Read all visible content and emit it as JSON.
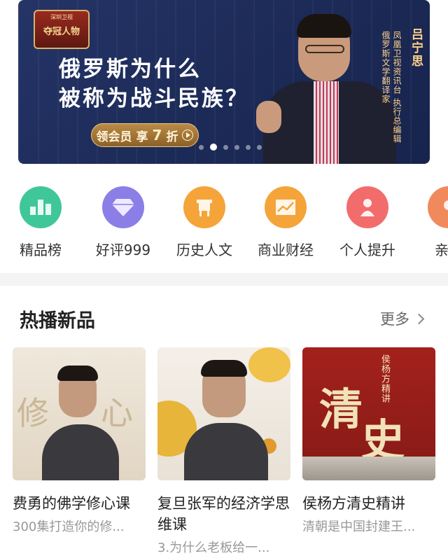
{
  "banner": {
    "badge_top": "深圳卫视",
    "badge_text": "夺冠人物",
    "headline_line1": "俄罗斯为什么",
    "headline_line2": "被称为战斗民族？",
    "vip_label": "领会员",
    "vip_discount_prefix": "享",
    "vip_discount_num": "7",
    "vip_discount_suffix": "折",
    "speaker_name": "吕宁思",
    "speaker_title1": "凤凰卫视资讯台 执行总编辑",
    "speaker_title2": "俄罗斯文学翻译家",
    "dots_total": 8,
    "dots_active": 1
  },
  "categories": [
    {
      "label": "精品榜",
      "icon": "bar-chart-icon",
      "color": "#3fc79a"
    },
    {
      "label": "好评999",
      "icon": "diamond-icon",
      "color": "#8b7ee6"
    },
    {
      "label": "历史人文",
      "icon": "ancient-vessel-icon",
      "color": "#f5a43a"
    },
    {
      "label": "商业财经",
      "icon": "trend-chart-icon",
      "color": "#f5a43a"
    },
    {
      "label": "个人提升",
      "icon": "person-icon",
      "color": "#f26c6c"
    },
    {
      "label": "亲子",
      "icon": "family-icon",
      "color": "#f08a5d"
    }
  ],
  "section": {
    "title": "热播新品",
    "more_label": "更多"
  },
  "cards": [
    {
      "title": "费勇的佛学修心课",
      "subtitle": "300集打造你的修...",
      "thumb_text_left": "修",
      "thumb_text_right": "心"
    },
    {
      "title": "复旦张军的经济学思维课",
      "subtitle": "3.为什么老板给一..."
    },
    {
      "title": "侯杨方清史精讲",
      "subtitle": "清朝是中国封建王...",
      "thumb_text_1": "清",
      "thumb_text_2": "史",
      "thumb_vertical": "侯杨方精讲"
    }
  ]
}
